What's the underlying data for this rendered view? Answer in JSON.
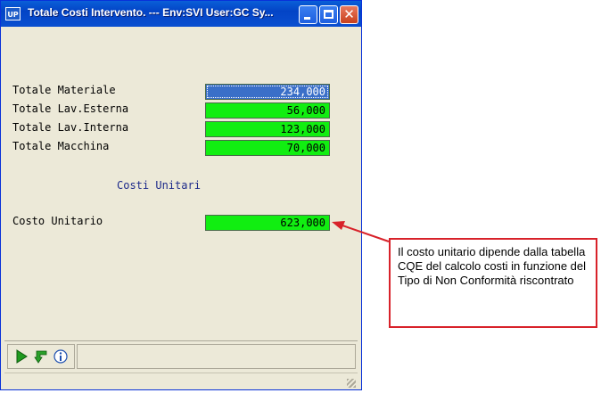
{
  "window": {
    "title": "Totale Costi Intervento. --- Env:SVI User:GC Sy...",
    "app_icon_text": "UP",
    "border_color": "#0831d9",
    "titlebar_color": "#0a5fd8"
  },
  "form": {
    "fields": [
      {
        "label": "Totale Materiale",
        "value": "234,000",
        "focused": true
      },
      {
        "label": "Totale Lav.Esterna",
        "value": "56,000",
        "focused": false
      },
      {
        "label": "Totale Lav.Interna",
        "value": "123,000",
        "focused": false
      },
      {
        "label": "Totale Macchina",
        "value": "70,000",
        "focused": false
      }
    ],
    "section_title": "Costi Unitari",
    "unit_cost": {
      "label": "Costo Unitario",
      "value": "623,000"
    },
    "field_color": "#11ee11",
    "focused_color": "#3a6fc8"
  },
  "toolbar": {
    "icons": [
      "play-icon",
      "refresh-arrow-icon",
      "info-icon"
    ]
  },
  "callout": {
    "text": "Il costo unitario dipende dalla tabella CQE del calcolo costi in funzione del Tipo di Non Conformità riscontrato",
    "border_color": "#d8222a"
  }
}
